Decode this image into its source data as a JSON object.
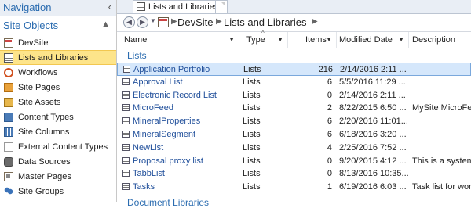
{
  "navigation": {
    "title": "Navigation",
    "collapse_glyph": "‹",
    "section_title": "Site Objects",
    "items": [
      {
        "label": "DevSite",
        "icon": "site-icon"
      },
      {
        "label": "Lists and Libraries",
        "icon": "lists-icon",
        "selected": true
      },
      {
        "label": "Workflows",
        "icon": "workflow-icon"
      },
      {
        "label": "Site Pages",
        "icon": "site-pages-icon"
      },
      {
        "label": "Site Assets",
        "icon": "site-assets-icon"
      },
      {
        "label": "Content Types",
        "icon": "content-types-icon"
      },
      {
        "label": "Site Columns",
        "icon": "site-columns-icon"
      },
      {
        "label": "External Content Types",
        "icon": "external-content-types-icon"
      },
      {
        "label": "Data Sources",
        "icon": "data-sources-icon"
      },
      {
        "label": "Master Pages",
        "icon": "master-pages-icon"
      },
      {
        "label": "Site Groups",
        "icon": "site-groups-icon"
      }
    ]
  },
  "tabs": {
    "active_label": "Lists and Libraries"
  },
  "breadcrumb": {
    "site": "DevSite",
    "page": "Lists and Libraries"
  },
  "table": {
    "columns": [
      "Name",
      "Type",
      "Items",
      "Modified Date",
      "Description"
    ],
    "group_label": "Lists",
    "next_group_label": "Document Libraries",
    "rows": [
      {
        "name": "Application Portfolio",
        "type": "Lists",
        "items": "216",
        "modified": "2/14/2016 2:11 ...",
        "description": "",
        "selected": true
      },
      {
        "name": "Approval List",
        "type": "Lists",
        "items": "6",
        "modified": "5/5/2016 11:29 ...",
        "description": ""
      },
      {
        "name": "Electronic Record List",
        "type": "Lists",
        "items": "0",
        "modified": "2/14/2016 2:11 ...",
        "description": ""
      },
      {
        "name": "MicroFeed",
        "type": "Lists",
        "items": "2",
        "modified": "8/22/2015 6:50 ...",
        "description": "MySite MicroFee"
      },
      {
        "name": "MineralProperties",
        "type": "Lists",
        "items": "6",
        "modified": "2/20/2016 11:01...",
        "description": ""
      },
      {
        "name": "MineralSegment",
        "type": "Lists",
        "items": "6",
        "modified": "6/18/2016 3:20 ...",
        "description": ""
      },
      {
        "name": "NewList",
        "type": "Lists",
        "items": "4",
        "modified": "2/25/2016 7:52 ...",
        "description": ""
      },
      {
        "name": "Proposal proxy list",
        "type": "Lists",
        "items": "0",
        "modified": "9/20/2015 4:12 ...",
        "description": "This is a system l"
      },
      {
        "name": "TabbList",
        "type": "Lists",
        "items": "0",
        "modified": "8/13/2016 10:35...",
        "description": ""
      },
      {
        "name": "Tasks",
        "type": "Lists",
        "items": "1",
        "modified": "6/19/2016 6:03 ...",
        "description": "Task list for work"
      }
    ]
  }
}
